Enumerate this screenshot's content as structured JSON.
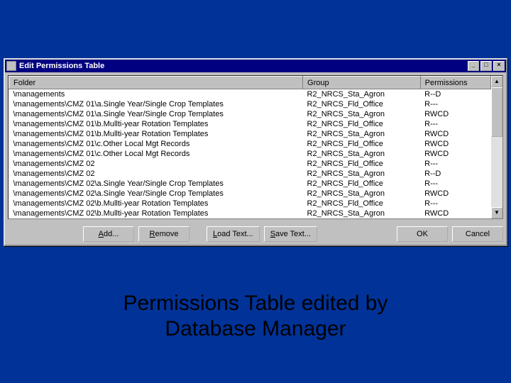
{
  "window": {
    "title": "Edit Permissions Table"
  },
  "columns": {
    "folder": "Folder",
    "group": "Group",
    "permissions": "Permissions"
  },
  "rows": [
    {
      "folder": "\\managements",
      "group": "R2_NRCS_Sta_Agron",
      "perm": "R--D"
    },
    {
      "folder": "\\managements\\CMZ 01\\a.Single Year/Single Crop Templates",
      "group": "R2_NRCS_Fld_Office",
      "perm": "R---"
    },
    {
      "folder": "\\managements\\CMZ 01\\a.Single Year/Single Crop Templates",
      "group": "R2_NRCS_Sta_Agron",
      "perm": "RWCD"
    },
    {
      "folder": "\\managements\\CMZ 01\\b.Mullti-year Rotation Templates",
      "group": "R2_NRCS_Fld_Office",
      "perm": "R---"
    },
    {
      "folder": "\\managements\\CMZ 01\\b.Mullti-year Rotation Templates",
      "group": "R2_NRCS_Sta_Agron",
      "perm": "RWCD"
    },
    {
      "folder": "\\managements\\CMZ 01\\c.Other Local Mgt Records",
      "group": "R2_NRCS_Fld_Office",
      "perm": "RWCD"
    },
    {
      "folder": "\\managements\\CMZ 01\\c.Other Local Mgt Records",
      "group": "R2_NRCS_Sta_Agron",
      "perm": "RWCD"
    },
    {
      "folder": "\\managements\\CMZ 02",
      "group": "R2_NRCS_Fld_Office",
      "perm": "R---"
    },
    {
      "folder": "\\managements\\CMZ 02",
      "group": "R2_NRCS_Sta_Agron",
      "perm": "R--D"
    },
    {
      "folder": "\\managements\\CMZ 02\\a.Single Year/Single Crop Templates",
      "group": "R2_NRCS_Fld_Office",
      "perm": "R---"
    },
    {
      "folder": "\\managements\\CMZ 02\\a.Single Year/Single Crop Templates",
      "group": "R2_NRCS_Sta_Agron",
      "perm": "RWCD"
    },
    {
      "folder": "\\managements\\CMZ 02\\b.Mullti-year Rotation Templates",
      "group": "R2_NRCS_Fld_Office",
      "perm": "R---"
    },
    {
      "folder": "\\managements\\CMZ 02\\b.Mullti-year Rotation Templates",
      "group": "R2_NRCS_Sta_Agron",
      "perm": "RWCD"
    }
  ],
  "buttons": {
    "add": "Add...",
    "remove": "Remove",
    "loadText": "Load Text...",
    "saveText": "Save Text...",
    "ok": "OK",
    "cancel": "Cancel"
  },
  "accel": {
    "add": "A",
    "remove": "R",
    "loadText": "L",
    "saveText": "S"
  },
  "caption": {
    "line1": "Permissions Table edited by",
    "line2": "Database Manager"
  }
}
